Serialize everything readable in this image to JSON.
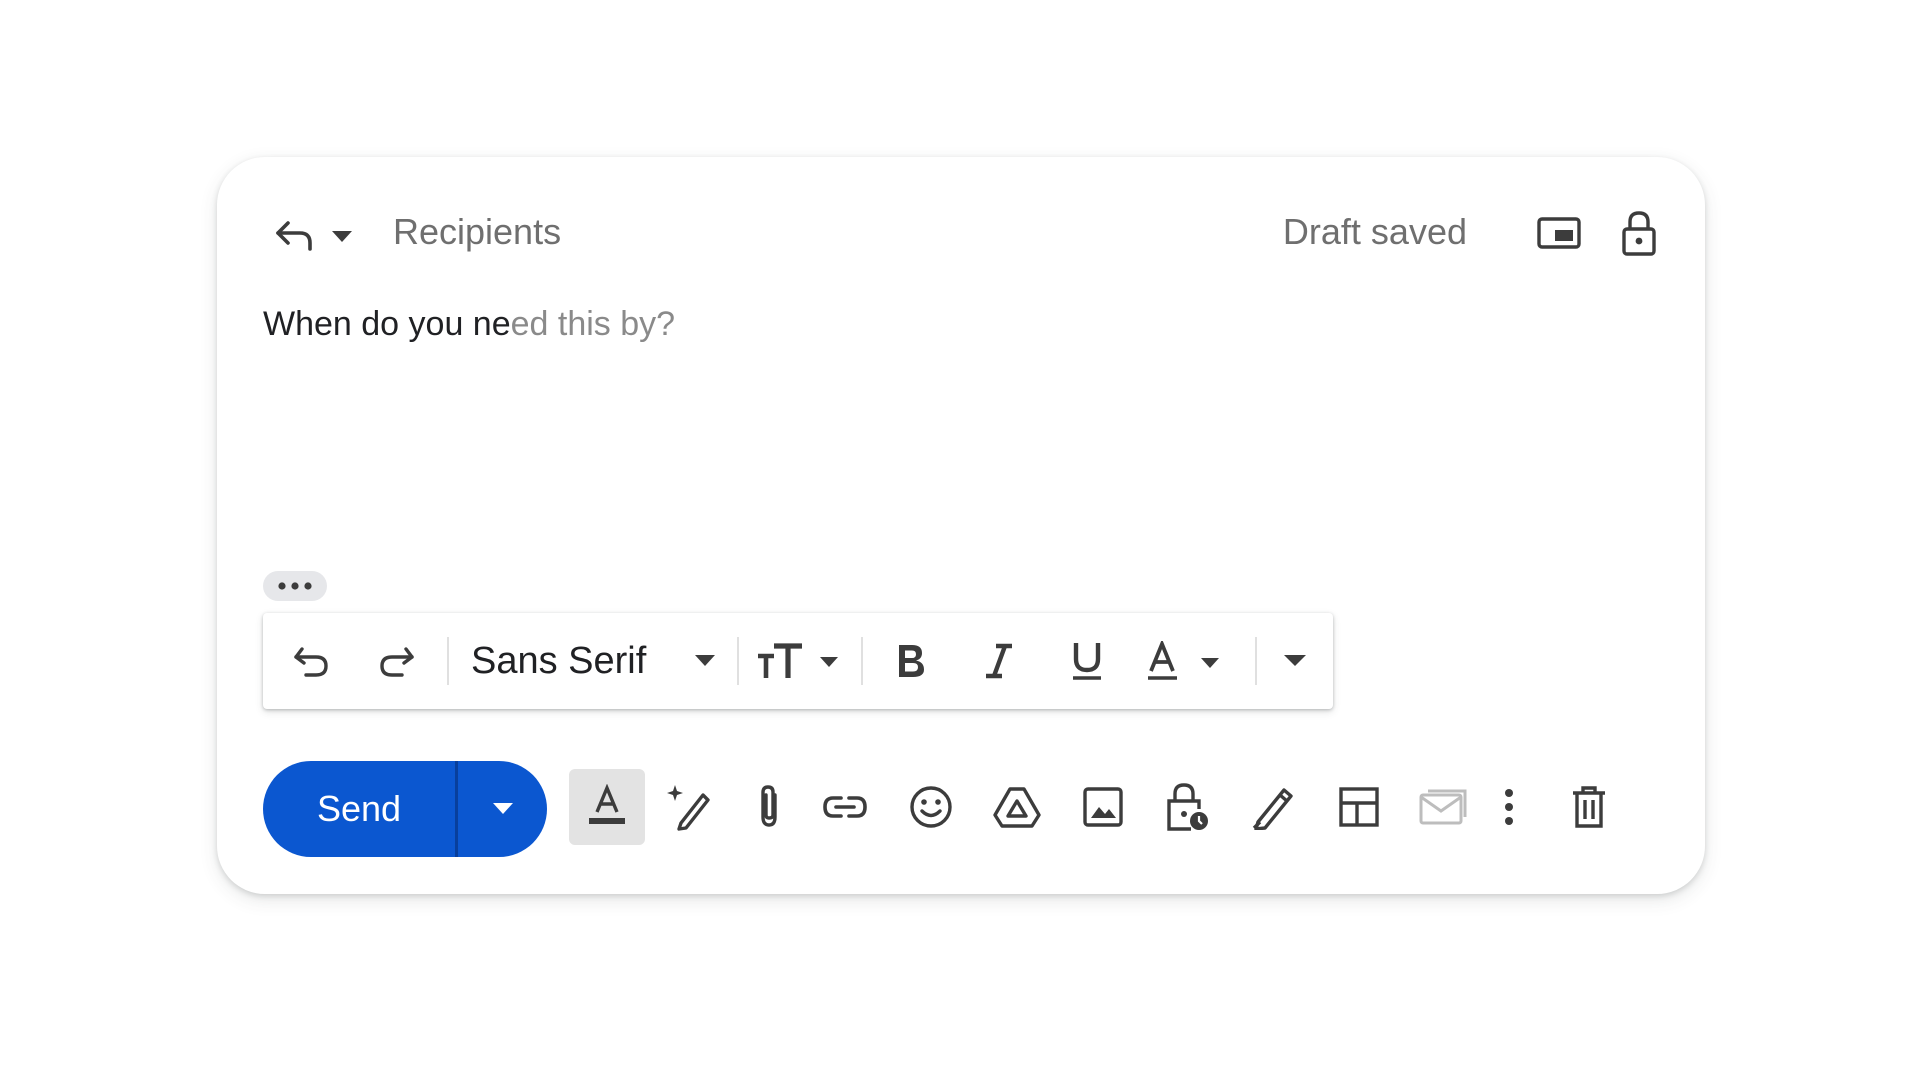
{
  "header": {
    "recipients_placeholder": "Recipients",
    "status": "Draft saved",
    "icons": [
      "reply-icon",
      "caret-down-icon",
      "pop-out-icon",
      "confidential-lock-icon"
    ]
  },
  "body": {
    "typed_text": "When do you ne",
    "suggestion_text": "ed this by?"
  },
  "format_bar": {
    "font_family": "Sans Serif",
    "icons": [
      "undo-icon",
      "redo-icon",
      "font-size-icon",
      "bold-icon",
      "italic-icon",
      "underline-icon",
      "text-color-icon",
      "more-formatting-icon"
    ]
  },
  "toolbar": {
    "send_label": "Send",
    "icons": [
      "formatting-options-icon",
      "help-me-write-icon",
      "attach-file-icon",
      "insert-link-icon",
      "emoji-icon",
      "google-drive-icon",
      "insert-photo-icon",
      "confidential-mode-icon",
      "signature-icon",
      "layouts-icon",
      "mail-merge-icon",
      "more-options-icon",
      "discard-draft-icon"
    ]
  },
  "colors": {
    "send_button": "#0b57d0",
    "icon": "#3c3c3c",
    "muted_text": "#6f6f6f",
    "suggestion_text": "#8a8a8a"
  }
}
